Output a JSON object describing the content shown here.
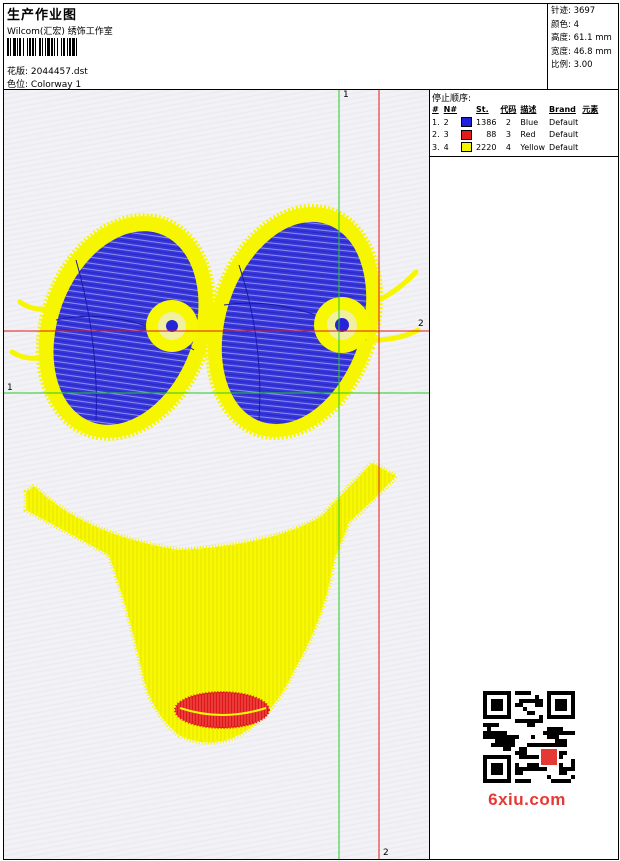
{
  "header": {
    "title": "生产作业图",
    "company": "Wilcom(汇宏) 绣饰工作室",
    "design_label": "花版:",
    "design_value": "2044457.dst",
    "colorway_label": "色位:",
    "colorway_value": "Colorway 1"
  },
  "stats": [
    {
      "label": "针迹:",
      "value": "3697"
    },
    {
      "label": "颜色:",
      "value": "4"
    },
    {
      "label": "高度:",
      "value": "61.1 mm"
    },
    {
      "label": "宽度:",
      "value": "46.8 mm"
    },
    {
      "label": "比例:",
      "value": "3.00"
    }
  ],
  "sequence": {
    "title": "停止顺序:",
    "headers": [
      "#",
      "N#",
      "St.",
      "代码",
      "描述",
      "Brand",
      "元素"
    ],
    "rows": [
      {
        "index": "1.",
        "n": "2",
        "color": "#1f1fe0",
        "stitches": "1386",
        "code": "2",
        "desc": "Blue",
        "brand": "Default"
      },
      {
        "index": "2.",
        "n": "3",
        "color": "#e41b1b",
        "stitches": "88",
        "code": "3",
        "desc": "Red",
        "brand": "Default"
      },
      {
        "index": "3.",
        "n": "4",
        "color": "#f4f400",
        "stitches": "2220",
        "code": "4",
        "desc": "Yellow",
        "brand": "Default"
      }
    ]
  },
  "canvas": {
    "guide_green_v": "1",
    "guide_green_h": "1",
    "guide_red_v": "2",
    "guide_red_h": "2",
    "colors": {
      "blue": "#2424d8",
      "yellow": "#f6f600",
      "red": "#e01818",
      "green": "#22cc22"
    }
  },
  "watermark": {
    "text": "6xiu.com"
  }
}
